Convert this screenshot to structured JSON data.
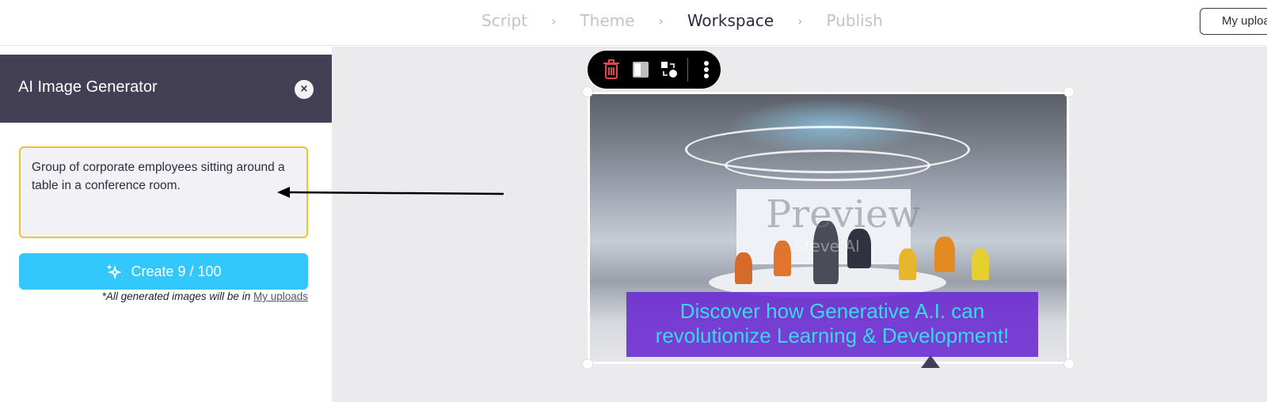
{
  "steps": [
    {
      "label": "Script",
      "active": false
    },
    {
      "label": "Theme",
      "active": false
    },
    {
      "label": "Workspace",
      "active": true
    },
    {
      "label": "Publish",
      "active": false
    }
  ],
  "step_separator": "›",
  "header": {
    "my_uploads_label": "My uploads"
  },
  "panel": {
    "title": "AI Image Generator",
    "close_icon": "×",
    "prompt_value": "Group of corporate employees sitting around a table in a conference room.",
    "create_label": "Create 9 / 100",
    "note_prefix": "*All generated images will be in ",
    "note_link": "My uploads"
  },
  "toolbar": {
    "icons": [
      "trash-icon",
      "flip-icon",
      "replace-icon",
      "more-icon"
    ],
    "trash_color": "#e0484a"
  },
  "canvas": {
    "watermark": "Preview",
    "watermark_sub": "Steve.AI",
    "caption": "Discover how Generative A.I. can revolutionize Learning & Development!",
    "caption_bg": "#6a28d2",
    "caption_color": "#37d9e8"
  },
  "colors": {
    "accent": "#32c8fb",
    "panel_header": "#434055",
    "prompt_border": "#f6c125"
  }
}
